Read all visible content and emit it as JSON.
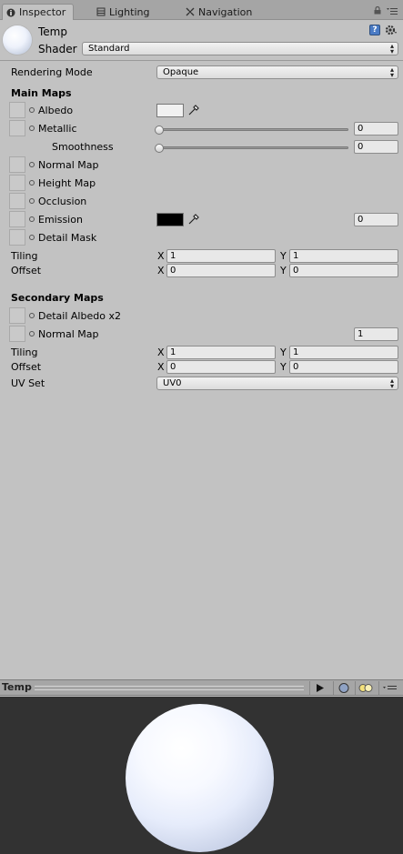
{
  "tabs": [
    {
      "label": "Inspector",
      "icon": "info-icon",
      "active": true
    },
    {
      "label": "Lighting",
      "icon": "lighting-icon",
      "active": false
    },
    {
      "label": "Navigation",
      "icon": "navigation-icon",
      "active": false
    }
  ],
  "material": {
    "name": "Temp",
    "shader_label": "Shader",
    "shader_value": "Standard"
  },
  "rendering": {
    "label": "Rendering Mode",
    "value": "Opaque"
  },
  "main_maps": {
    "title": "Main Maps",
    "albedo": {
      "label": "Albedo",
      "color": "#f1f1f1"
    },
    "metallic": {
      "label": "Metallic",
      "value": "0",
      "slider": 0
    },
    "smoothness": {
      "label": "Smoothness",
      "value": "0",
      "slider": 0
    },
    "normal_map": {
      "label": "Normal Map"
    },
    "height_map": {
      "label": "Height Map"
    },
    "occlusion": {
      "label": "Occlusion"
    },
    "emission": {
      "label": "Emission",
      "color": "#000000",
      "value": "0"
    },
    "detail_mask": {
      "label": "Detail Mask"
    },
    "tiling": {
      "label": "Tiling",
      "x_label": "X",
      "x": "1",
      "y_label": "Y",
      "y": "1"
    },
    "offset": {
      "label": "Offset",
      "x_label": "X",
      "x": "0",
      "y_label": "Y",
      "y": "0"
    }
  },
  "secondary_maps": {
    "title": "Secondary Maps",
    "detail_albedo": {
      "label": "Detail Albedo x2"
    },
    "normal_map": {
      "label": "Normal Map",
      "value": "1"
    },
    "tiling": {
      "label": "Tiling",
      "x_label": "X",
      "x": "1",
      "y_label": "Y",
      "y": "1"
    },
    "offset": {
      "label": "Offset",
      "x_label": "X",
      "x": "0",
      "y_label": "Y",
      "y": "0"
    },
    "uv_set": {
      "label": "UV Set",
      "value": "UV0"
    }
  },
  "preview": {
    "title": "Temp"
  }
}
